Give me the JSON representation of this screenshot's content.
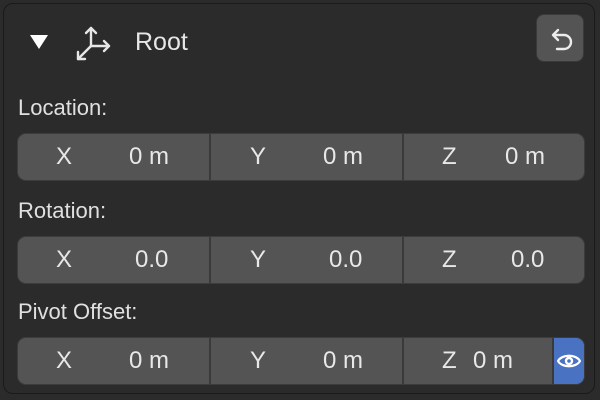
{
  "header": {
    "title": "Root",
    "collapse_icon": "triangle-down-icon",
    "object_icon": "empty-axes-icon",
    "reset_icon": "undo-arrow-icon"
  },
  "sections": {
    "location": {
      "label": "Location:",
      "fields": [
        {
          "axis": "X",
          "value": "0 m"
        },
        {
          "axis": "Y",
          "value": "0 m"
        },
        {
          "axis": "Z",
          "value": "0 m"
        }
      ]
    },
    "rotation": {
      "label": "Rotation:",
      "fields": [
        {
          "axis": "X",
          "value": "0.0"
        },
        {
          "axis": "Y",
          "value": "0.0"
        },
        {
          "axis": "Z",
          "value": "0.0"
        }
      ]
    },
    "pivot_offset": {
      "label": "Pivot Offset:",
      "fields": [
        {
          "axis": "X",
          "value": "0 m"
        },
        {
          "axis": "Y",
          "value": "0 m"
        },
        {
          "axis": "Z",
          "value": "0 m"
        }
      ],
      "toggle_icon": "eye-icon"
    }
  },
  "colors": {
    "panel_bg": "#2b2b2b",
    "field_bg": "#545454",
    "text": "#e8e8e8",
    "toggle_active": "#4a72c2"
  }
}
